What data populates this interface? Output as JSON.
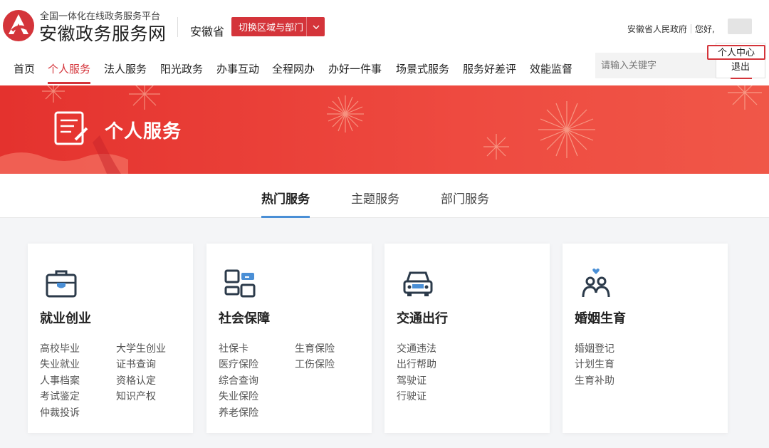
{
  "header": {
    "brand_sub": "全国一体化在线政务服务平台",
    "brand_main": "安徽政务服务网",
    "province": "安徽省",
    "switch_label": "切换区域与部门",
    "gov_label": "安徽省人民政府",
    "greeting": "您好,",
    "search_placeholder": "请输入关键字",
    "user_menu": {
      "center": "个人中心",
      "logout": "退出"
    }
  },
  "nav": [
    "首页",
    "个人服务",
    "法人服务",
    "阳光政务",
    "办事互动",
    "全程网办",
    "办好一件事",
    "场景式服务",
    "服务好差评",
    "效能监督"
  ],
  "nav_active_index": 1,
  "banner": {
    "title": "个人服务"
  },
  "tabs": [
    "热门服务",
    "主题服务",
    "部门服务"
  ],
  "active_tab_index": 0,
  "cards": [
    {
      "title": "就业创业",
      "icon": "briefcase-icon",
      "links": [
        "高校毕业",
        "大学生创业",
        "失业就业",
        "证书查询",
        "人事档案",
        "资格认定",
        "考试鉴定",
        "知识产权",
        "仲裁投诉"
      ]
    },
    {
      "title": "社会保障",
      "icon": "social-security-icon",
      "links": [
        "社保卡",
        "生育保险",
        "医疗保险",
        "工伤保险",
        "综合查询",
        "失业保险",
        "养老保险"
      ]
    },
    {
      "title": "交通出行",
      "icon": "car-icon",
      "links": [
        "交通违法",
        "出行帮助",
        "驾驶证",
        "行驶证"
      ]
    },
    {
      "title": "婚姻生育",
      "icon": "family-icon",
      "links": [
        "婚姻登记",
        "计划生育",
        "生育补助"
      ]
    }
  ],
  "colors": {
    "brand_red": "#d4343a",
    "tab_underline": "#4a8fd6"
  }
}
